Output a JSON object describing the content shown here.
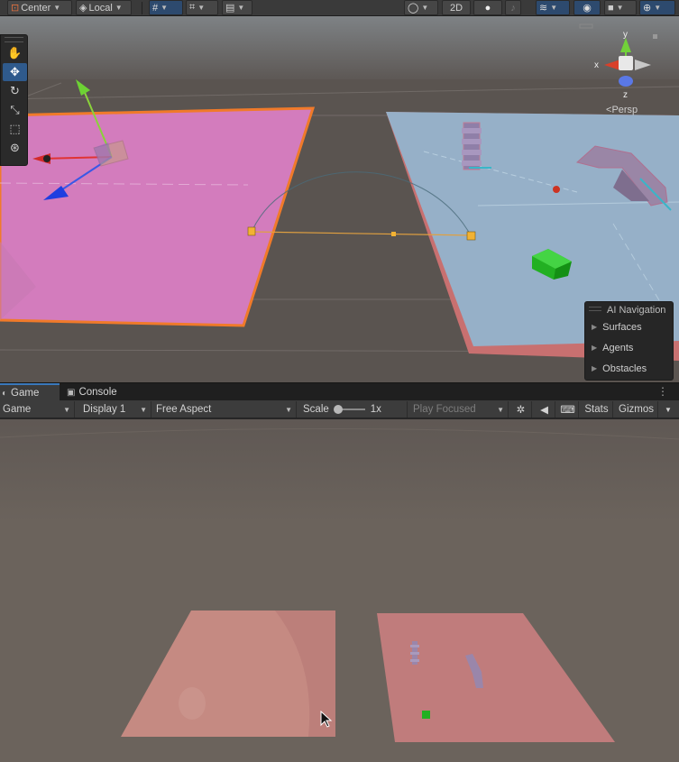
{
  "scene_toolbar": {
    "pivot_label": "Center",
    "space_label": "Local",
    "mode_2d_label": "2D"
  },
  "scene_view": {
    "persp_label": "Persp",
    "gizmo_axes": {
      "x": "x",
      "y": "y",
      "z": "z"
    },
    "ai_navigation": {
      "title": "AI Navigation",
      "items": [
        "Surfaces",
        "Agents",
        "Obstacles"
      ]
    }
  },
  "tabs": [
    {
      "label": "Game",
      "active": true
    },
    {
      "label": "Console",
      "active": false
    }
  ],
  "game_toolbar": {
    "view_mode": "Game",
    "display": "Display 1",
    "aspect": "Free Aspect",
    "scale_label": "Scale",
    "scale_value": "1x",
    "play_mode": "Play Focused",
    "stats_label": "Stats",
    "gizmos_label": "Gizmos"
  },
  "colors": {
    "pink_plane": "#d37cbd",
    "blue_plane": "#96b0c8",
    "game_plane": "#c07c7c",
    "accent_blue": "#3a79bb"
  }
}
